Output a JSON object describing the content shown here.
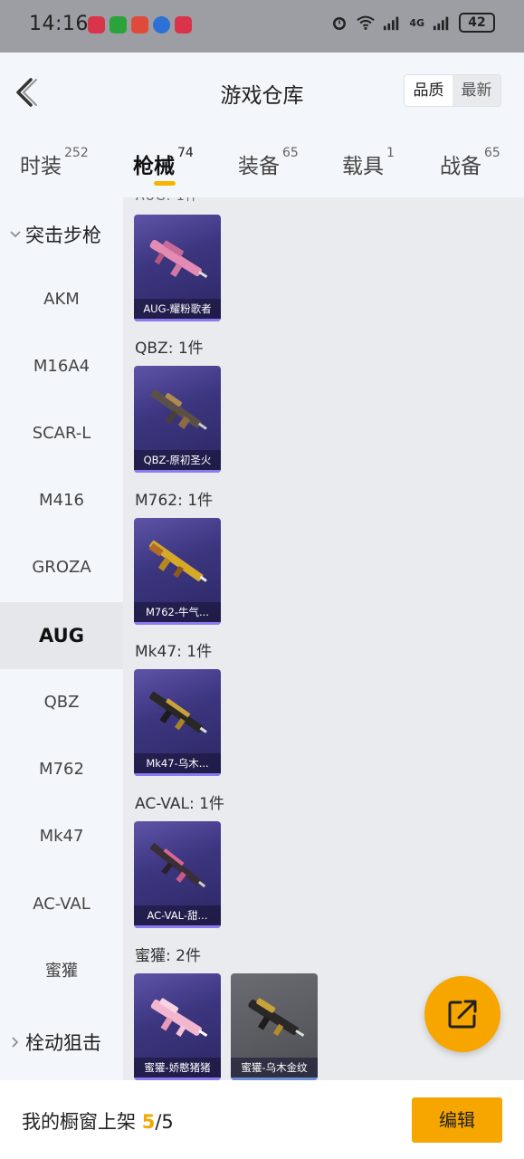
{
  "status_bar": {
    "time": "14:16",
    "network": "4G",
    "battery": "42"
  },
  "header": {
    "title": "游戏仓库",
    "sort_options": [
      "品质",
      "最新"
    ],
    "sort_selected": "品质"
  },
  "tabs": [
    {
      "label": "时装",
      "count": "252"
    },
    {
      "label": "枪械",
      "count": "74"
    },
    {
      "label": "装备",
      "count": "65"
    },
    {
      "label": "载具",
      "count": "1"
    },
    {
      "label": "战备",
      "count": "65"
    }
  ],
  "active_tab": "枪械",
  "sidebar": {
    "category_expanded": "突击步枪",
    "items": [
      "AKM",
      "M16A4",
      "SCAR-L",
      "M416",
      "GROZA",
      "AUG",
      "QBZ",
      "M762",
      "Mk47",
      "AC-VAL",
      "蜜獾"
    ],
    "selected": "AUG",
    "category_collapsed": "栓动狙击"
  },
  "content": {
    "groups": [
      {
        "label": "QBZ: 1件",
        "items": [
          {
            "name": "QBZ-原初圣火"
          }
        ]
      },
      {
        "label": "M762: 1件",
        "items": [
          {
            "name": "M762-牛气..."
          }
        ]
      },
      {
        "label": "Mk47: 1件",
        "items": [
          {
            "name": "Mk47-乌木..."
          }
        ]
      },
      {
        "label": "AC-VAL: 1件",
        "items": [
          {
            "name": "AC-VAL-甜..."
          }
        ]
      },
      {
        "label": "蜜獾: 2件",
        "items": [
          {
            "name": "蜜獾-娇憨猪猪"
          },
          {
            "name": "蜜獾-乌木金纹"
          }
        ]
      }
    ],
    "top_item": {
      "name": "AUG-耀粉歌者"
    }
  },
  "bottom": {
    "label": "我的橱窗上架",
    "count": "5",
    "total": "/5",
    "edit_label": "编辑"
  },
  "colors": {
    "accent": "#f7a600",
    "card_purple": "#3d3680",
    "card_gray": "#4c4e54"
  }
}
